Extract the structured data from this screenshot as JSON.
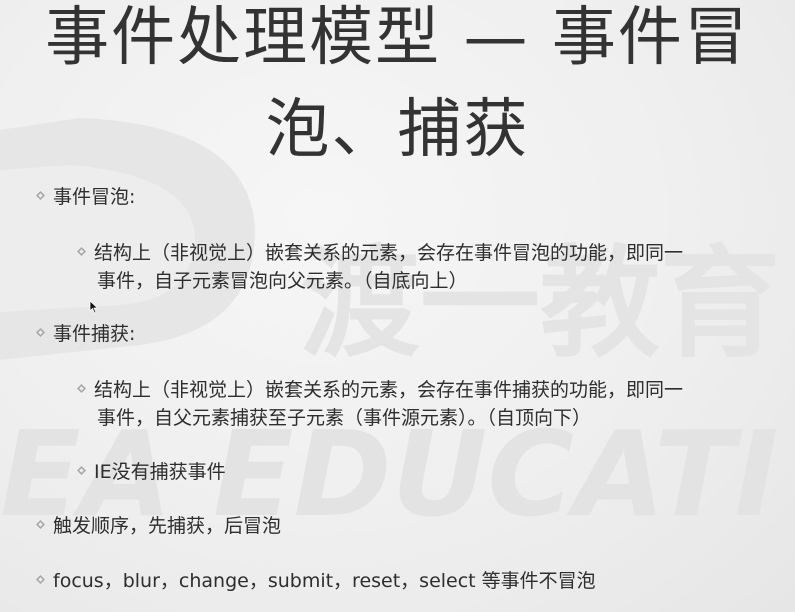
{
  "slide": {
    "title_line1": "事件处理模型 — 事件冒",
    "title_line2": "泡、捕获",
    "items": [
      {
        "text": "事件冒泡:"
      },
      {
        "text": "结构上（非视觉上）嵌套关系的元素，会存在事件冒泡的功能，即同一",
        "cont": "事件，自子元素冒泡向父元素。（自底向上）"
      },
      {
        "text": "事件捕获:"
      },
      {
        "text": "结构上（非视觉上）嵌套关系的元素，会存在事件捕获的功能，即同一",
        "cont": "事件，自父元素捕获至子元素（事件源元素）。（自顶向下）"
      },
      {
        "text": "IE没有捕获事件"
      },
      {
        "text": "触发顺序，先捕获，后冒泡"
      },
      {
        "text": "focus，blur，change，submit，reset，select 等事件不冒泡"
      }
    ],
    "watermark_text": "渡一教育",
    "watermark_subtext": "EA EDUCATI"
  },
  "icons": {
    "bullet": "diamond-bullet-icon",
    "cursor": "mouse-pointer-icon"
  },
  "colors": {
    "background": "#efefef",
    "text": "#2e2e2e",
    "title": "#333333",
    "bullet": "#a8a8a8",
    "watermark": "#e2e2e2"
  }
}
